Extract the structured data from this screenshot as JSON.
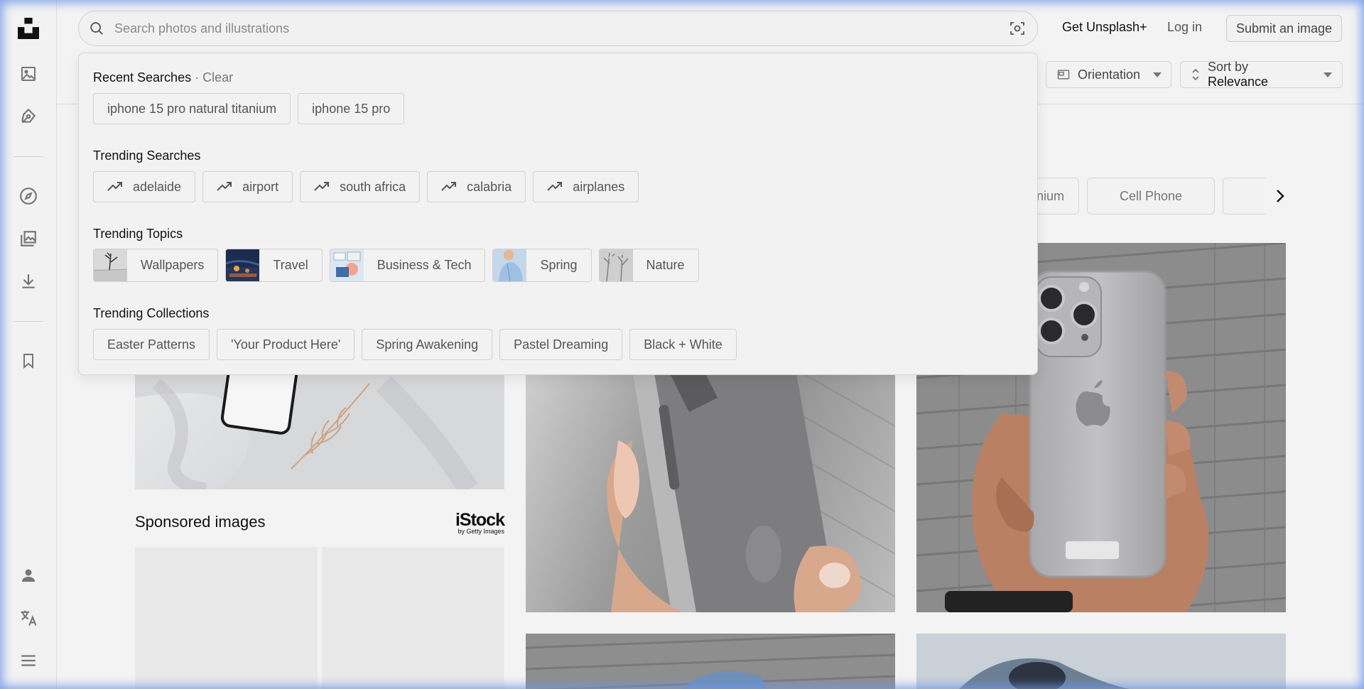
{
  "rail": {
    "items": [
      "unsplash-logo",
      "photos-icon",
      "illustrations-icon",
      "explore-icon",
      "collections-icon",
      "download-icon",
      "bookmark-icon",
      "user-icon",
      "translate-icon",
      "menu-icon"
    ]
  },
  "header": {
    "search_placeholder": "Search photos and illustrations",
    "get_plus": "Get Unsplash+",
    "login": "Log in",
    "submit": "Submit an image"
  },
  "filters": {
    "orientation": "Orientation",
    "sort_prefix": "Sort by",
    "sort_value": "Relevance"
  },
  "related": {
    "partial_chip": "anium",
    "cell_phone": "Cell Phone"
  },
  "sponsored": {
    "title": "Sponsored images",
    "brand": "iStock",
    "brand_sub": "by Getty Images"
  },
  "dropdown": {
    "recent_title": "Recent Searches",
    "recent_sep": " · ",
    "clear": "Clear",
    "recent": [
      "iphone 15 pro natural titanium",
      "iphone 15 pro"
    ],
    "trending_searches_title": "Trending Searches",
    "trending_searches": [
      "adelaide",
      "airport",
      "south africa",
      "calabria",
      "airplanes"
    ],
    "trending_topics_title": "Trending Topics",
    "trending_topics": [
      "Wallpapers",
      "Travel",
      "Business & Tech",
      "Spring",
      "Nature"
    ],
    "trending_collections_title": "Trending Collections",
    "trending_collections": [
      "Easter Patterns",
      "'Your Product Here'",
      "Spring Awakening",
      "Pastel Dreaming",
      "Black + White"
    ]
  },
  "colors": {
    "background": "#f3f3f3",
    "text_primary": "#111111",
    "text_muted": "#767676",
    "border": "#d1d1d1",
    "glow": "#6e96eb"
  }
}
